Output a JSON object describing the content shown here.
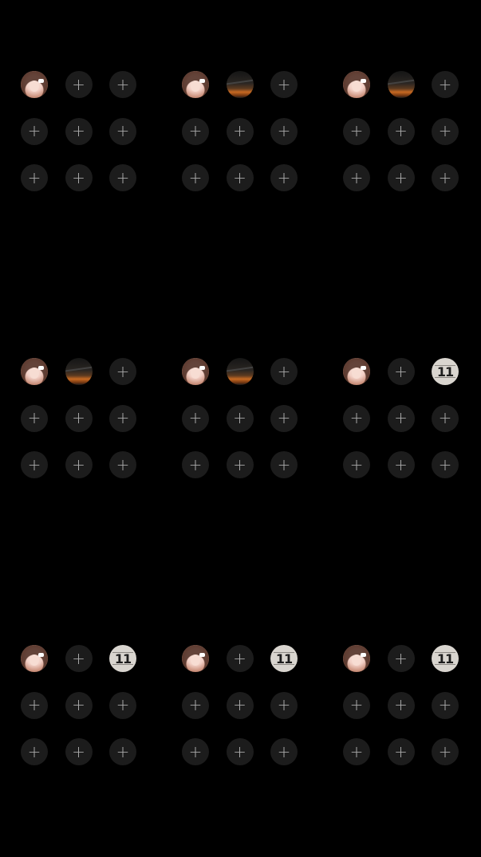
{
  "plus_glyph": "+",
  "number_label": "11",
  "colors": {
    "background": "#000000",
    "empty_slot": "#1c1c1c",
    "plus": "#a9a9a9",
    "number_badge": "#d9d5cf"
  },
  "grids": [
    {
      "slots": [
        "avatar",
        "empty",
        "empty",
        "empty",
        "empty",
        "empty",
        "empty",
        "empty",
        "empty"
      ]
    },
    {
      "slots": [
        "avatar",
        "sunset",
        "empty",
        "empty",
        "empty",
        "empty",
        "empty",
        "empty",
        "empty"
      ]
    },
    {
      "slots": [
        "avatar",
        "sunset",
        "empty",
        "empty",
        "empty",
        "empty",
        "empty",
        "empty",
        "empty"
      ]
    },
    {
      "slots": [
        "avatar",
        "sunset",
        "empty",
        "empty",
        "empty",
        "empty",
        "empty",
        "empty",
        "empty"
      ]
    },
    {
      "slots": [
        "avatar",
        "sunset",
        "empty",
        "empty",
        "empty",
        "empty",
        "empty",
        "empty",
        "empty"
      ]
    },
    {
      "slots": [
        "avatar",
        "empty",
        "number",
        "empty",
        "empty",
        "empty",
        "empty",
        "empty",
        "empty"
      ]
    },
    {
      "slots": [
        "avatar",
        "empty",
        "number",
        "empty",
        "empty",
        "empty",
        "empty",
        "empty",
        "empty"
      ]
    },
    {
      "slots": [
        "avatar",
        "empty",
        "number",
        "empty",
        "empty",
        "empty",
        "empty",
        "empty",
        "empty"
      ]
    },
    {
      "slots": [
        "avatar",
        "empty",
        "number",
        "empty",
        "empty",
        "empty",
        "empty",
        "empty",
        "empty"
      ]
    }
  ]
}
